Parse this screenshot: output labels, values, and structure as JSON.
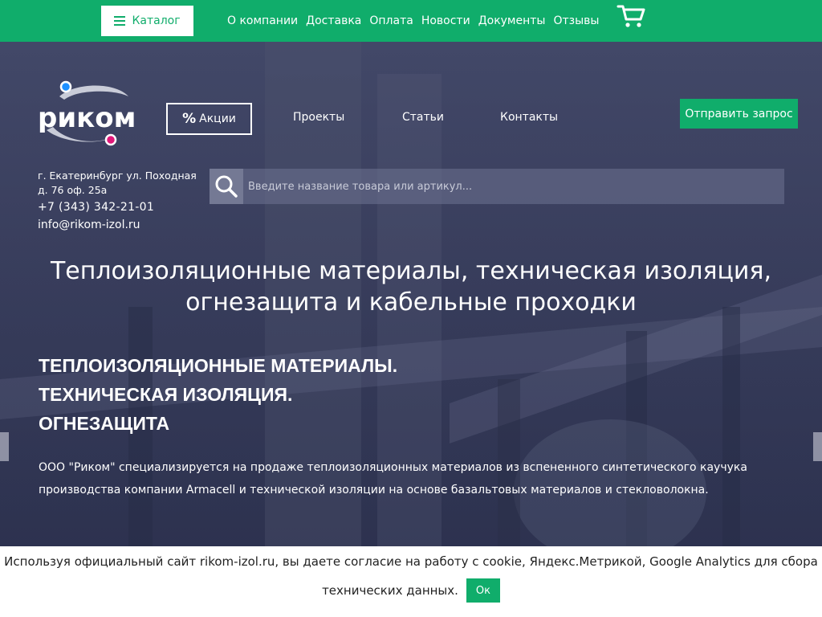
{
  "topbar": {
    "catalog_label": "Каталог",
    "nav": [
      "О компании",
      "Доставка",
      "Оплата",
      "Новости",
      "Документы",
      "Отзывы"
    ]
  },
  "header": {
    "logo_text": "рикoм",
    "promo_label": "Акции",
    "nav": [
      "Проекты",
      "Статьи",
      "Контакты"
    ],
    "send_request_label": "Отправить запрос"
  },
  "contacts": {
    "address": "г. Екатеринбург ул. Походная д. 76 оф. 25а",
    "phone": "+7 (343) 342-21-01",
    "email": "info@rikom-izol.ru"
  },
  "search": {
    "placeholder": "Введите название товара или артикул..."
  },
  "hero": {
    "title_line1": "Теплоизоляционные материалы, техническая изоляция,",
    "title_line2": "огнезащита и кабельные проходки",
    "subtitle_lines": [
      "ТЕПЛОИЗОЛЯЦИОННЫЕ МАТЕРИАЛЫ.",
      "ТЕХНИЧЕСКАЯ ИЗОЛЯЦИЯ.",
      "ОГНЕЗАЩИТА"
    ],
    "description": "ООО \"Риком\" специализируется на продаже теплоизоляционных материалов из вспененного синтетического каучука производства компании Armacell и технической изоляции на основе базальтовых материалов и стекловолокна."
  },
  "cookie": {
    "line1": "Используя официальный сайт rikom-izol.ru, вы даете согласие на работу с cookie, Яндекс.Метрикой, Google Analytics для сбора",
    "line2": "технических данных.",
    "ok_label": "Ок"
  },
  "colors": {
    "brand_green": "#10ad6b",
    "logo_blue": "#1e90ff",
    "logo_pink": "#e0187a"
  },
  "icons": [
    "hamburger-icon",
    "cart-icon",
    "percent-icon",
    "search-icon",
    "arrow-left",
    "arrow-right"
  ]
}
